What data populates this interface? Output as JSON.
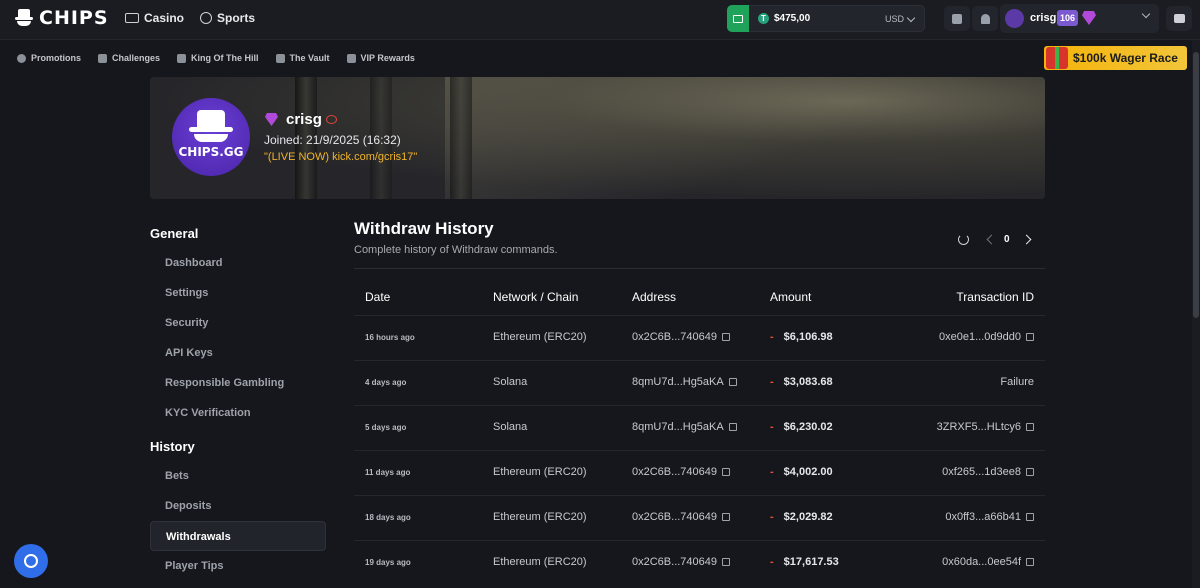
{
  "brand": {
    "name": "CHIPS"
  },
  "topnav": [
    {
      "label": "Casino",
      "icon": "cards-icon"
    },
    {
      "label": "Sports",
      "icon": "sports-icon"
    }
  ],
  "wallet": {
    "balance": "$475,00",
    "currency": "USD",
    "accent": "#1fa35a"
  },
  "user": {
    "name": "crisg",
    "level": "106"
  },
  "subnav": [
    {
      "label": "Promotions",
      "icon": "promotions-icon"
    },
    {
      "label": "Challenges",
      "icon": "challenges-icon"
    },
    {
      "label": "King Of The Hill",
      "icon": "crown-icon"
    },
    {
      "label": "The Vault",
      "icon": "vault-icon"
    },
    {
      "label": "VIP Rewards",
      "icon": "vip-icon"
    }
  ],
  "promo": {
    "label": "$100k Wager Race"
  },
  "profile": {
    "avatar_text": "CHIPS.GG",
    "name": "crisg",
    "joined": "Joined: 21/9/2025 (16:32)",
    "stream": "\"(LIVE NOW) kick.com/gcris17\""
  },
  "sidebar": {
    "general_heading": "General",
    "general_items": [
      "Dashboard",
      "Settings",
      "Security",
      "API Keys",
      "Responsible Gambling",
      "KYC Verification"
    ],
    "history_heading": "History",
    "history_items": [
      "Bets",
      "Deposits",
      "Withdrawals",
      "Player Tips"
    ],
    "active_item": "Withdrawals"
  },
  "main": {
    "title": "Withdraw History",
    "subtitle": "Complete history of Withdraw commands.",
    "page": "0",
    "columns": [
      "Date",
      "Network / Chain",
      "Address",
      "Amount",
      "Transaction ID"
    ],
    "rows": [
      {
        "date": "16 hours ago",
        "network": "Ethereum (ERC20)",
        "address": "0x2C6B...740649",
        "sign": "-",
        "amount": "$6,106.98",
        "tx": "0xe0e1...0d9dd0"
      },
      {
        "date": "4 days ago",
        "network": "Solana",
        "address": "8qmU7d...Hg5aKA",
        "sign": "-",
        "amount": "$3,083.68",
        "tx": "Failure"
      },
      {
        "date": "5 days ago",
        "network": "Solana",
        "address": "8qmU7d...Hg5aKA",
        "sign": "-",
        "amount": "$6,230.02",
        "tx": "3ZRXF5...HLtcy6"
      },
      {
        "date": "11 days ago",
        "network": "Ethereum (ERC20)",
        "address": "0x2C6B...740649",
        "sign": "-",
        "amount": "$4,002.00",
        "tx": "0xf265...1d3ee8"
      },
      {
        "date": "18 days ago",
        "network": "Ethereum (ERC20)",
        "address": "0x2C6B...740649",
        "sign": "-",
        "amount": "$2,029.82",
        "tx": "0x0ff3...a66b41"
      },
      {
        "date": "19 days ago",
        "network": "Ethereum (ERC20)",
        "address": "0x2C6B...740649",
        "sign": "-",
        "amount": "$17,617.53",
        "tx": "0x60da...0ee54f"
      }
    ]
  }
}
